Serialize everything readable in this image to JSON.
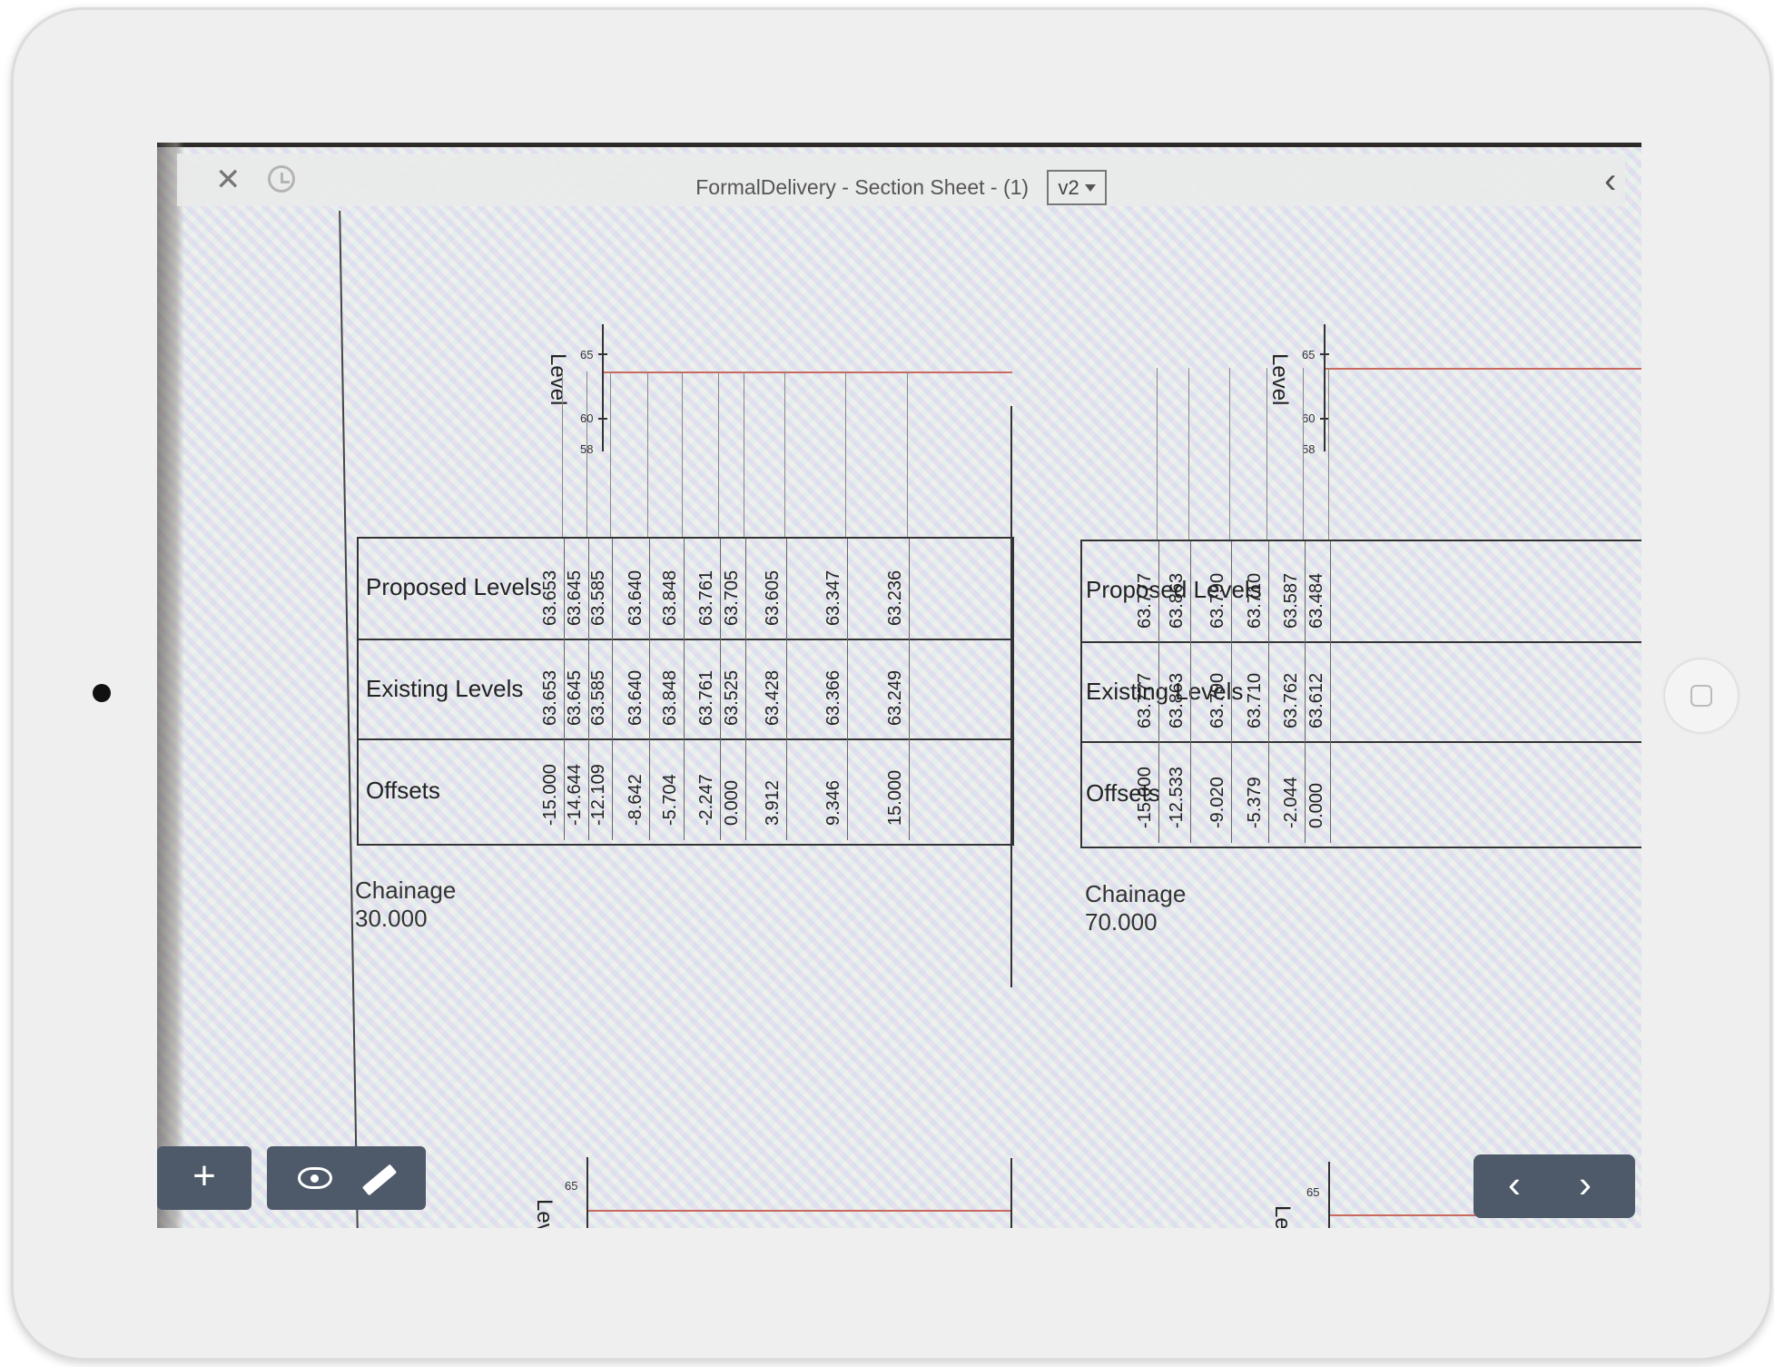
{
  "window": {
    "title": "FormalDelivery - Section Sheet - (1)",
    "version": "v2"
  },
  "icons": {
    "close": "close-icon",
    "history": "history-icon",
    "back": "chevron-left-icon",
    "add": "plus-icon",
    "view": "eye-icon",
    "measure": "ruler-icon",
    "prev_page": "chevron-left-icon",
    "next_page": "chevron-right-icon"
  },
  "toolbar": {
    "add_label": "+",
    "prev_label": "‹",
    "next_label": "›"
  },
  "sections": [
    {
      "chainage": "Chainage 30.000",
      "axis_label": "Level",
      "ticks": [
        "65",
        "60",
        "58"
      ],
      "row_labels": [
        "Proposed Levels",
        "Existing Levels",
        "Offsets"
      ],
      "proposed": [
        "63.653",
        "63.645",
        "63.585",
        "63.640",
        "63.848",
        "63.761",
        "63.705",
        "63.605",
        "63.347",
        "63.236"
      ],
      "existing": [
        "63.653",
        "63.645",
        "63.585",
        "63.640",
        "63.848",
        "63.761",
        "63.525",
        "63.428",
        "63.366",
        "63.249"
      ],
      "offsets": [
        "-15.000",
        "-14.644",
        "-12.109",
        "-8.642",
        "-5.704",
        "-2.247",
        "0.000",
        "3.912",
        "9.346",
        "15.000"
      ]
    },
    {
      "chainage": "Chainage 70.000",
      "axis_label": "Level",
      "ticks": [
        "65",
        "60",
        "58"
      ],
      "row_labels": [
        "Proposed Levels",
        "Existing Levels",
        "Offsets"
      ],
      "proposed": [
        "63.777",
        "63.863",
        "63.790",
        "63.710",
        "63.587",
        "63.484"
      ],
      "existing": [
        "63.777",
        "63.863",
        "63.790",
        "63.710",
        "63.762",
        "63.612"
      ],
      "offsets": [
        "-15.000",
        "-12.533",
        "-9.020",
        "-5.379",
        "-2.044",
        "0.000"
      ]
    }
  ],
  "partial_sections": [
    {
      "axis_label": "Lev",
      "tick": "65"
    },
    {
      "axis_label": "Le",
      "tick": "65"
    }
  ]
}
